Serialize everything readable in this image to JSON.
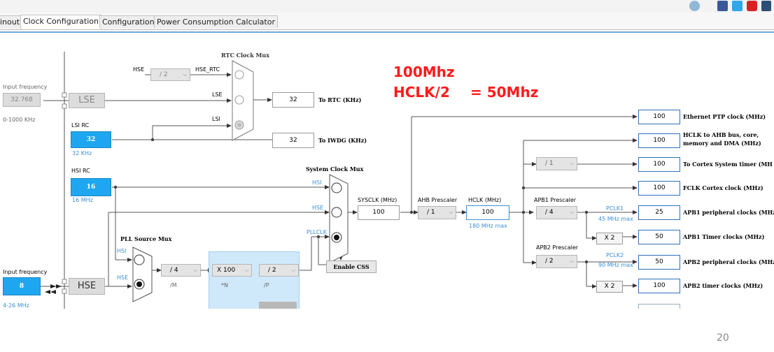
{
  "tabs": [
    "inout",
    "Clock Configuration",
    "Configuration",
    "Power Consumption Calculator"
  ],
  "annotation": {
    "line1": "100Mhz",
    "line2": "HCLK/2",
    "line3": "= 50Mhz"
  },
  "left": {
    "input_frequency_label": "Input frequency",
    "lse_freq": "32.768",
    "lse_range": "0-1000 KHz",
    "lse_label": "LSE",
    "lsi_label": "LSI RC",
    "lsi_value": "32",
    "lsi_unit": "32 KHz",
    "hsi_label": "HSI RC",
    "hsi_value": "16",
    "hsi_unit": "16 MHz",
    "hse_input_label": "Input frequency",
    "hse_freq": "8",
    "hse_range": "4-26 MHz",
    "hse_label": "HSE"
  },
  "rtc": {
    "mux_title": "RTC Clock Mux",
    "hse_label": "HSE",
    "div_value": "/ 2",
    "hse_rtc_label": "HSE_RTC",
    "lse_label": "LSE",
    "lsi_label": "LSI",
    "rtc_value": "32",
    "rtc_label": "To RTC (KHz)",
    "iwdg_value": "32",
    "iwdg_label": "To IWDG (KHz)"
  },
  "sysmux": {
    "title": "System Clock Mux",
    "hsi": "HSI",
    "hse": "HSE",
    "pllclk": "PLLCLK",
    "enable_css": "Enable CSS"
  },
  "pll": {
    "title": "PLL Source Mux",
    "hsi": "HSI",
    "hse": "HSE",
    "m_value": "/ 4",
    "m_label": "/M",
    "n_value": "X 100",
    "n_label": "*N",
    "p_value": "/ 2",
    "p_label": "/P"
  },
  "sysclk": {
    "label": "SYSCLK (MHz)",
    "value": "100"
  },
  "ahb": {
    "label": "AHB Prescaler",
    "value": "/ 1"
  },
  "hclk": {
    "label": "HCLK (MHz)",
    "value": "100",
    "max": "180 MHz max"
  },
  "apb1": {
    "label": "APB1 Prescaler",
    "value": "/ 4",
    "pclk_label": "PCLK1",
    "pclk_max": "45 MHz max",
    "x2": "X 2"
  },
  "apb2": {
    "label": "APB2 Prescaler",
    "value": "/ 2",
    "pclk_label": "PCLK2",
    "pclk_max": "90 MHz max",
    "x2": "X 2"
  },
  "cortex_div": "/ 1",
  "outputs": [
    {
      "value": "100",
      "label": "Ethernet PTP clock (MHz)"
    },
    {
      "value": "100",
      "label": "HCLK to AHB bus, core,",
      "label2": "memory and DMA (MHz)"
    },
    {
      "value": "100",
      "label": "To Cortex System timer (MH"
    },
    {
      "value": "100",
      "label": "FCLK Cortex clock (MHz)"
    },
    {
      "value": "25",
      "label": "APB1 peripheral clocks (MHz"
    },
    {
      "value": "50",
      "label": "APB1 Timer clocks (MHz)"
    },
    {
      "value": "50",
      "label": "APB2 peripheral clocks (MHz"
    },
    {
      "value": "100",
      "label": "APB2 timer clocks (MHz)"
    }
  ],
  "page_number": "20",
  "colors": {
    "input_box": "#1ea7f0",
    "annotation": "#ff1a1a",
    "canvas_border": "#6aa7d8"
  }
}
